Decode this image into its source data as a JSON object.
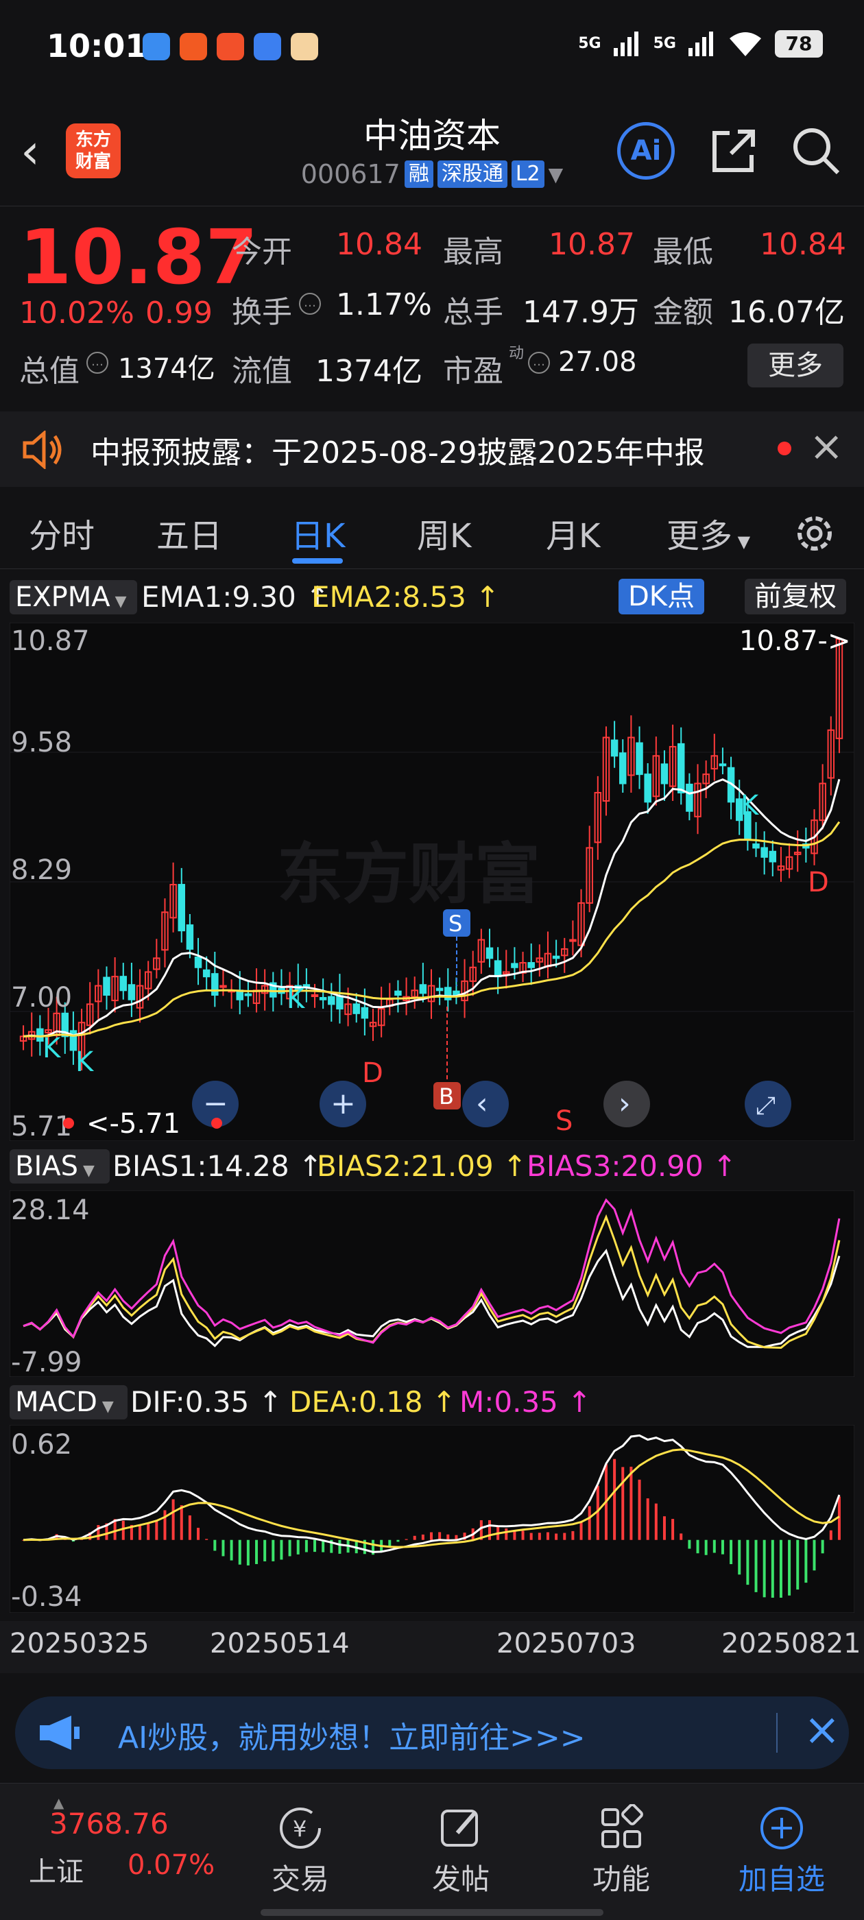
{
  "status": {
    "time": "10:01",
    "signal1": "5G",
    "signal2": "5G",
    "battery": "78"
  },
  "header": {
    "logo_text_1": "东方",
    "logo_text_2": "财富",
    "name": "中油资本",
    "code": "000617",
    "tags": [
      "融",
      "深股通",
      "L2"
    ],
    "ai_label": "Ai"
  },
  "quote": {
    "price": "10.87",
    "change_pct": "10.02%",
    "change_val": "0.99",
    "open_label": "今开",
    "open": "10.84",
    "high_label": "最高",
    "high": "10.87",
    "low_label": "最低",
    "low": "10.84",
    "turnover_label": "换手",
    "turnover": "1.17%",
    "volume_label": "总手",
    "volume": "147.9万",
    "amount_label": "金额",
    "amount": "16.07亿",
    "mktcap_label": "总值",
    "mktcap": "1374亿",
    "float_label": "流值",
    "float": "1374亿",
    "pe_label": "市盈",
    "pe_sup": "动",
    "pe": "27.08",
    "more": "更多"
  },
  "notice": {
    "text": "中报预披露：于2025-08-29披露2025年中报"
  },
  "tabs": [
    "分时",
    "五日",
    "日K",
    "周K",
    "月K",
    "更多"
  ],
  "active_tab": "日K",
  "kline_panel": {
    "indicator": "EXPMA",
    "ema1": "EMA1:9.30",
    "ema2": "EMA2:8.53",
    "dk_button": "DK点",
    "adjust_button": "前复权",
    "y_labels": [
      "10.87",
      "9.58",
      "8.29",
      "7.00",
      "5.71"
    ],
    "last_price_marker": "10.87->",
    "low_marker": "<-5.71",
    "marks": [
      "K",
      "K",
      "K",
      "K",
      "D",
      "D",
      "S",
      "B",
      "S"
    ],
    "watermark": "东方财富"
  },
  "bias_panel": {
    "indicator": "BIAS",
    "bias1": "BIAS1:14.28",
    "bias2": "BIAS2:21.09",
    "bias3": "BIAS3:20.90",
    "y_top": "28.14",
    "y_bottom": "-7.99"
  },
  "macd_panel": {
    "indicator": "MACD",
    "dif": "DIF:0.35",
    "dea": "DEA:0.18",
    "m": "M:0.35",
    "y_top": "0.62",
    "y_bottom": "-0.34"
  },
  "dates": [
    "20250325",
    "20250514",
    "20250703",
    "20250821"
  ],
  "chart_data": {
    "type": "candlestick",
    "ylim": [
      5.71,
      10.87
    ],
    "x_ticks": [
      "20250325",
      "20250514",
      "20250703",
      "20250821"
    ],
    "close": [
      6.55,
      6.6,
      6.5,
      6.62,
      6.8,
      6.55,
      6.4,
      6.7,
      6.9,
      7.1,
      7.0,
      7.2,
      7.05,
      6.95,
      7.1,
      7.25,
      7.4,
      7.9,
      8.2,
      7.7,
      7.5,
      7.3,
      7.2,
      7.0,
      7.1,
      7.05,
      6.95,
      7.0,
      7.05,
      7.1,
      6.98,
      7.02,
      7.1,
      7.05,
      7.08,
      7.0,
      6.95,
      6.9,
      6.85,
      6.9,
      6.8,
      6.75,
      6.7,
      6.85,
      6.95,
      7.0,
      6.98,
      7.05,
      7.02,
      7.1,
      7.05,
      6.95,
      7.0,
      7.15,
      7.3,
      7.6,
      7.4,
      7.2,
      7.25,
      7.3,
      7.35,
      7.3,
      7.4,
      7.45,
      7.4,
      7.5,
      7.6,
      8.0,
      8.6,
      9.2,
      9.8,
      9.6,
      9.3,
      9.8,
      9.4,
      9.1,
      9.6,
      9.3,
      9.7,
      9.2,
      9.0,
      9.3,
      9.4,
      9.6,
      9.5,
      9.1,
      8.9,
      8.7,
      8.6,
      8.5,
      8.45,
      8.4,
      8.5,
      8.55,
      8.6,
      8.9,
      9.3,
      9.88,
      10.87
    ],
    "ema1_last": 9.3,
    "ema2_last": 8.53
  }
}
